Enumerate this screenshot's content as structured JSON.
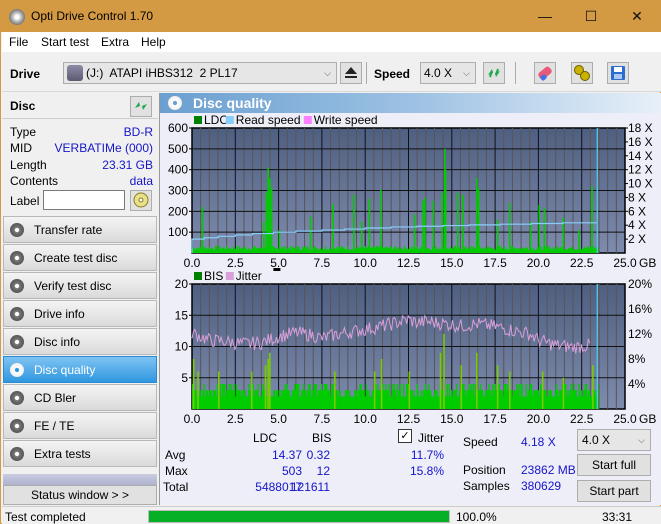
{
  "window": {
    "title": "Opti Drive Control 1.70",
    "minimize": "—",
    "maximize": "☐",
    "close": "✕"
  },
  "menu": [
    "File",
    "Start test",
    "Extra",
    "Help"
  ],
  "toolbar": {
    "drive_label": "Drive",
    "drive_value": "(J:)  ATAPI iHBS312  2 PL17",
    "speed_label": "Speed",
    "speed_value": "4.0 X"
  },
  "disc": {
    "header": "Disc",
    "rows": [
      {
        "key": "Type",
        "value": "BD-R"
      },
      {
        "key": "MID",
        "value": "VERBATIMe (000)"
      },
      {
        "key": "Length",
        "value": "23.31 GB"
      },
      {
        "key": "Contents",
        "value": "data"
      }
    ],
    "label_key": "Label",
    "label_value": ""
  },
  "nav": [
    {
      "label": "Transfer rate",
      "active": false
    },
    {
      "label": "Create test disc",
      "active": false
    },
    {
      "label": "Verify test disc",
      "active": false
    },
    {
      "label": "Drive info",
      "active": false
    },
    {
      "label": "Disc info",
      "active": false
    },
    {
      "label": "Disc quality",
      "active": true
    },
    {
      "label": "CD Bler",
      "active": false
    },
    {
      "label": "FE / TE",
      "active": false
    },
    {
      "label": "Extra tests",
      "active": false
    }
  ],
  "status_window_button": "Status window > >",
  "panel": {
    "title": "Disc quality"
  },
  "colors": {
    "ldc": "#008000",
    "read_speed": "#87cefa",
    "write_speed": "#ff80ff",
    "bis": "#008000",
    "jitter": "#d8a0d8",
    "bar_fill": "#00cc00",
    "progress": "#06b025",
    "plot_bg_top": "#4e5f82",
    "plot_bg_bottom": "#7d8bae"
  },
  "chart_data": [
    {
      "type": "bar",
      "title": "LDC / Read speed",
      "legend": [
        "LDC",
        "Read speed",
        "Write speed"
      ],
      "legend_position": "top-left",
      "xlabel": "GB",
      "x_ticks": [
        "0.0",
        "2.5",
        "5.0",
        "7.5",
        "10.0",
        "12.5",
        "15.0",
        "17.5",
        "20.0",
        "22.5",
        "25.0"
      ],
      "xlim": [
        0,
        25
      ],
      "y_left_ticks": [
        "100",
        "200",
        "300",
        "400",
        "500",
        "600"
      ],
      "ylim_left": [
        0,
        600
      ],
      "y_right_ticks": [
        "2 X",
        "4 X",
        "6 X",
        "8 X",
        "10 X",
        "12 X",
        "14 X",
        "16 X",
        "18 X"
      ],
      "ylim_right": [
        0,
        18
      ],
      "grid": true,
      "ldc_baseline": 25,
      "ldc_spikes": [
        {
          "x": 0.55,
          "y": 220
        },
        {
          "x": 4.25,
          "y": 290
        },
        {
          "x": 4.35,
          "y": 410
        },
        {
          "x": 4.45,
          "y": 360
        },
        {
          "x": 4.55,
          "y": 310
        },
        {
          "x": 4.1,
          "y": 150
        },
        {
          "x": 5.0,
          "y": 110
        },
        {
          "x": 6.8,
          "y": 175
        },
        {
          "x": 8.1,
          "y": 235
        },
        {
          "x": 9.3,
          "y": 280
        },
        {
          "x": 9.75,
          "y": 150
        },
        {
          "x": 10.2,
          "y": 260
        },
        {
          "x": 10.85,
          "y": 305
        },
        {
          "x": 12.8,
          "y": 185
        },
        {
          "x": 13.3,
          "y": 250
        },
        {
          "x": 13.4,
          "y": 265
        },
        {
          "x": 13.9,
          "y": 250
        },
        {
          "x": 14.4,
          "y": 290
        },
        {
          "x": 14.55,
          "y": 500
        },
        {
          "x": 14.6,
          "y": 400
        },
        {
          "x": 15.3,
          "y": 290
        },
        {
          "x": 15.6,
          "y": 280
        },
        {
          "x": 16.4,
          "y": 360
        },
        {
          "x": 16.5,
          "y": 310
        },
        {
          "x": 17.6,
          "y": 160
        },
        {
          "x": 18.3,
          "y": 240
        },
        {
          "x": 19.5,
          "y": 150
        },
        {
          "x": 20.0,
          "y": 230
        },
        {
          "x": 20.3,
          "y": 215
        },
        {
          "x": 21.4,
          "y": 170
        },
        {
          "x": 22.3,
          "y": 110
        },
        {
          "x": 23.05,
          "y": 320
        }
      ],
      "read_speed_steps": [
        {
          "x0": 0.0,
          "x1": 0.7,
          "y": 2.0
        },
        {
          "x0": 0.7,
          "x1": 1.5,
          "y": 2.2
        },
        {
          "x0": 1.5,
          "x1": 2.5,
          "y": 2.4
        },
        {
          "x0": 2.5,
          "x1": 3.5,
          "y": 2.6
        },
        {
          "x0": 3.5,
          "x1": 4.7,
          "y": 2.8
        },
        {
          "x0": 4.7,
          "x1": 6.0,
          "y": 3.0
        },
        {
          "x0": 6.0,
          "x1": 7.5,
          "y": 3.15
        },
        {
          "x0": 7.5,
          "x1": 8.8,
          "y": 3.3
        },
        {
          "x0": 8.8,
          "x1": 10.0,
          "y": 3.45
        },
        {
          "x0": 10.0,
          "x1": 11.5,
          "y": 3.6
        },
        {
          "x0": 11.5,
          "x1": 13.0,
          "y": 3.75
        },
        {
          "x0": 13.0,
          "x1": 14.5,
          "y": 3.85
        },
        {
          "x0": 14.5,
          "x1": 16.0,
          "y": 3.95
        },
        {
          "x0": 16.0,
          "x1": 17.8,
          "y": 4.05
        },
        {
          "x0": 17.8,
          "x1": 19.6,
          "y": 4.15
        },
        {
          "x0": 19.6,
          "x1": 21.4,
          "y": 4.25
        },
        {
          "x0": 21.4,
          "x1": 23.4,
          "y": 4.35
        }
      ],
      "end_marker_x": 23.4
    },
    {
      "type": "bar",
      "title": "BIS / Jitter",
      "legend": [
        "BIS",
        "Jitter"
      ],
      "legend_position": "top-left",
      "xlabel": "GB",
      "x_ticks": [
        "0.0",
        "2.5",
        "5.0",
        "7.5",
        "10.0",
        "12.5",
        "15.0",
        "17.5",
        "20.0",
        "22.5",
        "25.0"
      ],
      "xlim": [
        0,
        25
      ],
      "y_left_ticks": [
        "5",
        "10",
        "15",
        "20"
      ],
      "ylim_left": [
        0,
        20
      ],
      "y_right_ticks": [
        "4%",
        "8%",
        "12%",
        "16%",
        "20%"
      ],
      "ylim_right": [
        0,
        20
      ],
      "grid": true,
      "bis_typical_max": 4,
      "bis_spikes": [
        {
          "x": 0.05,
          "y": 8
        },
        {
          "x": 0.3,
          "y": 6
        },
        {
          "x": 1.5,
          "y": 6
        },
        {
          "x": 3.4,
          "y": 6
        },
        {
          "x": 4.2,
          "y": 7
        },
        {
          "x": 4.35,
          "y": 8
        },
        {
          "x": 4.45,
          "y": 9
        },
        {
          "x": 8.2,
          "y": 6
        },
        {
          "x": 10.5,
          "y": 6
        },
        {
          "x": 10.9,
          "y": 8
        },
        {
          "x": 12.5,
          "y": 6
        },
        {
          "x": 14.3,
          "y": 9
        },
        {
          "x": 14.5,
          "y": 12
        },
        {
          "x": 15.5,
          "y": 7
        },
        {
          "x": 16.4,
          "y": 9
        },
        {
          "x": 17.6,
          "y": 7
        },
        {
          "x": 18.3,
          "y": 6
        },
        {
          "x": 20.2,
          "y": 6
        },
        {
          "x": 21.4,
          "y": 5
        },
        {
          "x": 23.1,
          "y": 7
        }
      ],
      "jitter_trend": [
        {
          "x": 0.0,
          "y": 12.2
        },
        {
          "x": 1.0,
          "y": 11.0
        },
        {
          "x": 2.0,
          "y": 10.8
        },
        {
          "x": 3.0,
          "y": 10.4
        },
        {
          "x": 4.0,
          "y": 10.6
        },
        {
          "x": 5.0,
          "y": 11.6
        },
        {
          "x": 6.0,
          "y": 12.2
        },
        {
          "x": 7.0,
          "y": 11.8
        },
        {
          "x": 7.5,
          "y": 11.3
        },
        {
          "x": 8.5,
          "y": 12.0
        },
        {
          "x": 9.5,
          "y": 12.5
        },
        {
          "x": 10.5,
          "y": 13.0
        },
        {
          "x": 11.5,
          "y": 13.6
        },
        {
          "x": 12.5,
          "y": 14.3
        },
        {
          "x": 13.0,
          "y": 13.8
        },
        {
          "x": 13.5,
          "y": 14.0
        },
        {
          "x": 14.5,
          "y": 13.7
        },
        {
          "x": 15.5,
          "y": 13.3
        },
        {
          "x": 16.5,
          "y": 13.6
        },
        {
          "x": 17.5,
          "y": 13.2
        },
        {
          "x": 18.5,
          "y": 12.6
        },
        {
          "x": 19.5,
          "y": 12.0
        },
        {
          "x": 20.0,
          "y": 11.0
        },
        {
          "x": 21.0,
          "y": 10.2
        },
        {
          "x": 22.0,
          "y": 9.9
        },
        {
          "x": 23.0,
          "y": 10.2
        }
      ],
      "end_marker_x": 23.4
    }
  ],
  "stats": {
    "col_ldc": "LDC",
    "col_bis": "BIS",
    "jitter_label": "Jitter",
    "jitter_checked": true,
    "rows": [
      {
        "label": "Avg",
        "ldc": "14.37",
        "bis": "0.32",
        "jitter": "11.7%"
      },
      {
        "label": "Max",
        "ldc": "503",
        "bis": "12",
        "jitter": "15.8%"
      },
      {
        "label": "Total",
        "ldc": "5488017",
        "bis": "121611",
        "jitter": ""
      }
    ],
    "speed_label": "Speed",
    "speed_value": "4.18 X",
    "position_label": "Position",
    "position_value": "23862 MB",
    "samples_label": "Samples",
    "samples_value": "380629",
    "speed_select": "4.0 X",
    "start_full": "Start full",
    "start_part": "Start part"
  },
  "statusbar": {
    "text": "Test completed",
    "progress_percent": 100.0,
    "progress_text": "100.0%",
    "time": "33:31"
  }
}
